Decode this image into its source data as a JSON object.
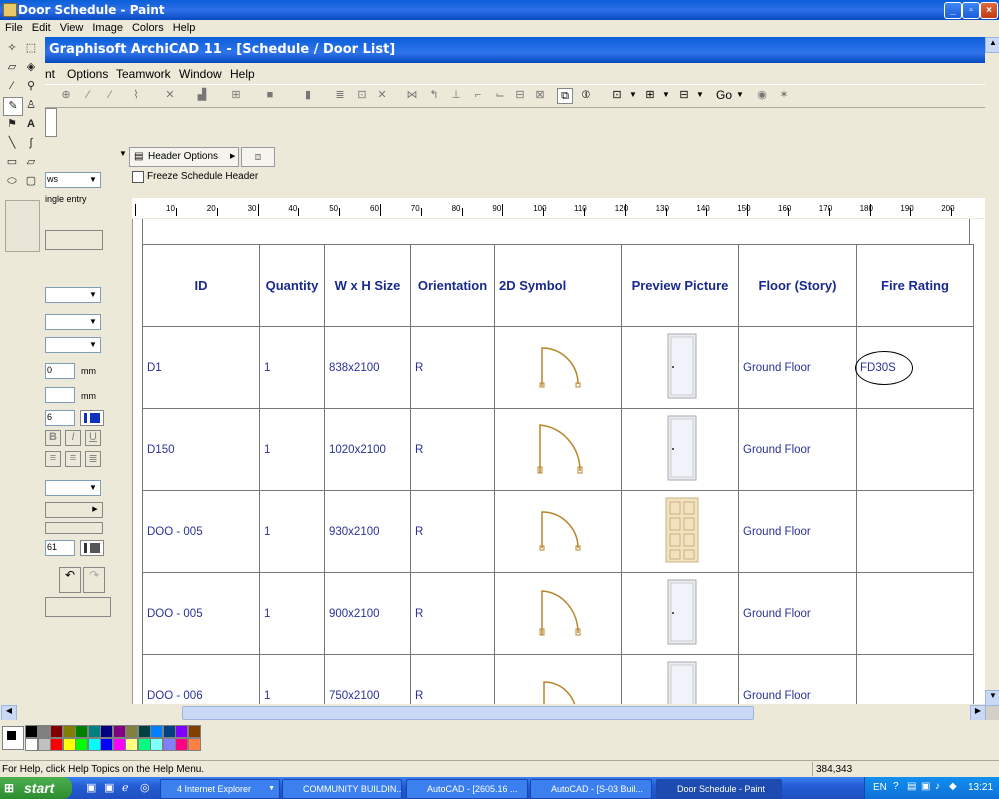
{
  "paint": {
    "title": "Door Schedule - Paint",
    "menu": [
      "File",
      "Edit",
      "View",
      "Image",
      "Colors",
      "Help"
    ],
    "status_help": "For Help, click Help Topics on the Help Menu.",
    "cursor_coords": "384,343"
  },
  "archicad": {
    "title": "Graphisoft ArchiCAD 11 - [Schedule /  Door List]",
    "menu": [
      "nt",
      "Options",
      "Teamwork",
      "Window",
      "Help"
    ],
    "toolbar_go": "Go",
    "panel": {
      "dropdown1": "ws",
      "text_entry": "ingle entry",
      "field_value1": "0",
      "unit1": "mm",
      "unit2": "mm",
      "field_value2": "6",
      "field_value3": "61",
      "bold": "B",
      "italic": "I",
      "underline": "U"
    },
    "header_options": "Header Options",
    "freeze_header": "Freeze Schedule Header",
    "ruler_labels": [
      "10",
      "20",
      "30",
      "40",
      "50",
      "60",
      "70",
      "80",
      "90",
      "100",
      "110",
      "120",
      "130",
      "140",
      "150",
      "160",
      "170",
      "180",
      "190",
      "200"
    ]
  },
  "schedule": {
    "headers": [
      "ID",
      "Quantity",
      "W x H Size",
      "Orientation",
      "2D Symbol",
      "Preview Picture",
      "Floor (Story)",
      "Fire Rating"
    ],
    "rows": [
      {
        "id": "D1",
        "qty": "1",
        "size": "838x2100",
        "orient": "R",
        "floor": "Ground Floor",
        "fire": "FD30S"
      },
      {
        "id": "D150",
        "qty": "1",
        "size": "1020x2100",
        "orient": "R",
        "floor": "Ground Floor",
        "fire": ""
      },
      {
        "id": "DOO - 005",
        "qty": "1",
        "size": "930x2100",
        "orient": "R",
        "floor": "Ground Floor",
        "fire": ""
      },
      {
        "id": "DOO - 005",
        "qty": "1",
        "size": "900x2100",
        "orient": "R",
        "floor": "Ground Floor",
        "fire": ""
      },
      {
        "id": "DOO - 006",
        "qty": "1",
        "size": "750x2100",
        "orient": "R",
        "floor": "Ground Floor",
        "fire": ""
      }
    ]
  },
  "taskbar": {
    "start": "start",
    "tasks": [
      "4 Internet Explorer",
      "COMMUNITY BUILDIN...",
      "AutoCAD - [2605.16 ...",
      "AutoCAD - [S-03 Buil...",
      "Door Schedule - Paint"
    ],
    "lang": "EN",
    "clock": "13:21"
  },
  "colors": {
    "accent": "#0a5fd8",
    "table_text": "#2a3296",
    "header_text": "#1a2a8c",
    "door_symbol": "#b8862a"
  }
}
